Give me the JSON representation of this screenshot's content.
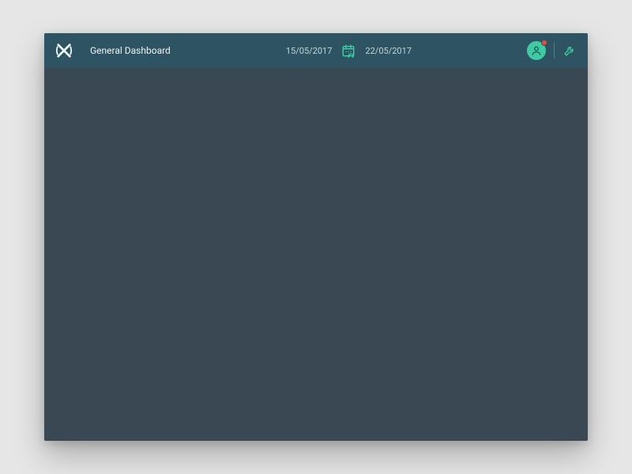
{
  "header": {
    "title": "General Dashboard",
    "date_from": "15/05/2017",
    "date_to": "22/05/2017"
  },
  "colors": {
    "topbar": "#2e5363",
    "content": "#394852",
    "accent": "#3fc9a4",
    "badge": "#e74c3c"
  },
  "icons": {
    "logo": "brand-x-logo",
    "calendar": "calendar-icon",
    "user": "user-icon",
    "settings": "wrench-icon"
  }
}
